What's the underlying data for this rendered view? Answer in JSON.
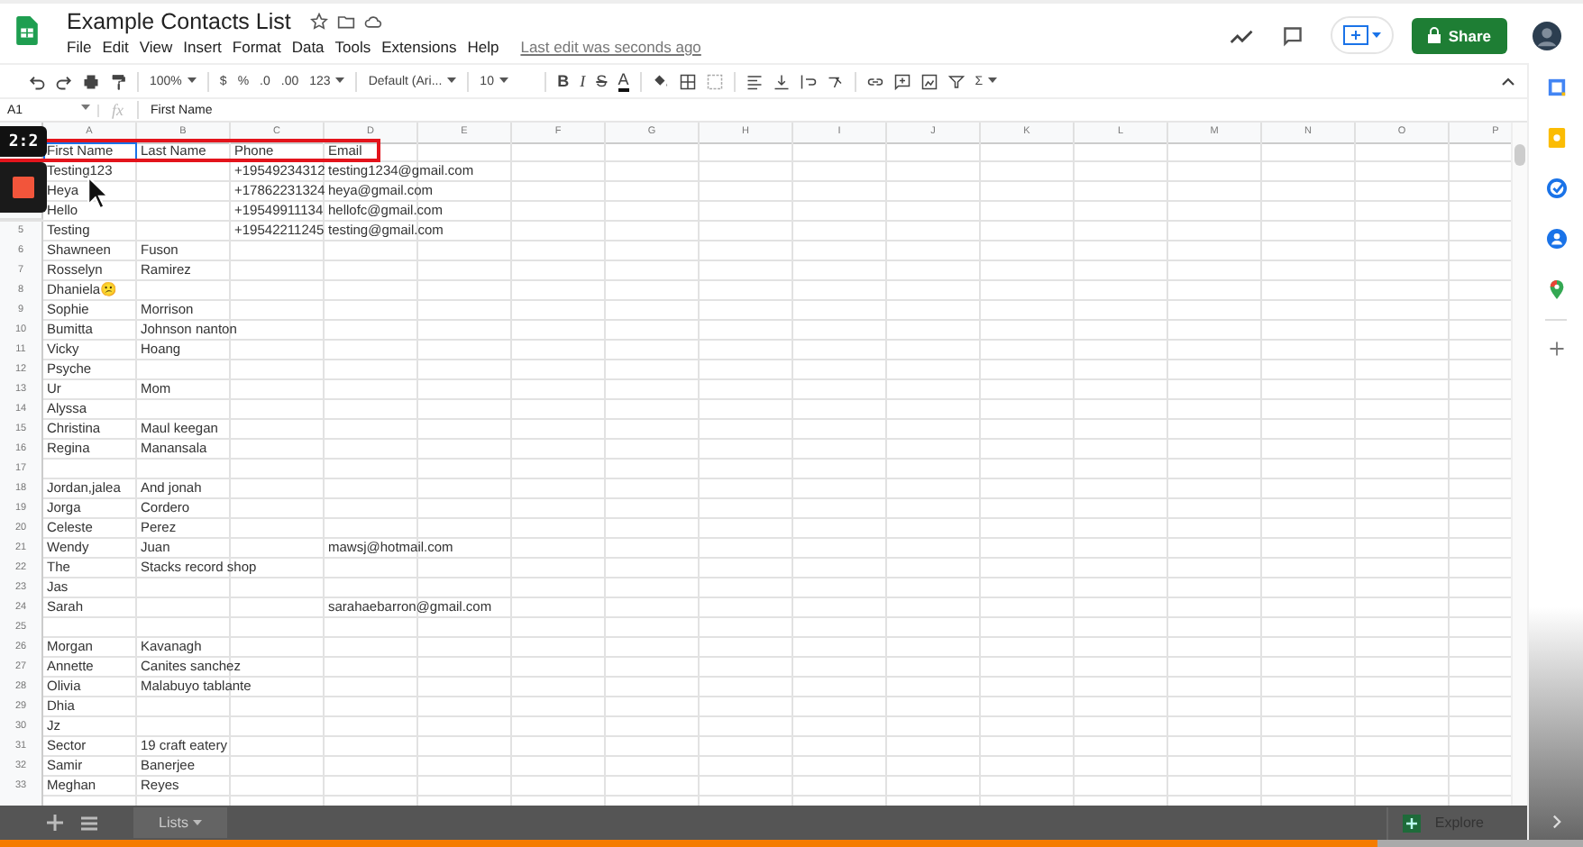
{
  "document": {
    "title": "Example Contacts List",
    "last_edit": "Last edit was seconds ago"
  },
  "menu": [
    "File",
    "Edit",
    "View",
    "Insert",
    "Format",
    "Data",
    "Tools",
    "Extensions",
    "Help"
  ],
  "share_button": "Share",
  "toolbar": {
    "zoom": "100%",
    "currency": "$",
    "percent": "%",
    "decrease_decimals": ".0",
    "increase_decimals": ".00",
    "number_format": "123",
    "font": "Default (Ari...",
    "font_size": "10",
    "bold": "B",
    "italic": "I",
    "strikethrough": "S",
    "text_color": "A",
    "functions": "Σ"
  },
  "formula_bar": {
    "name_box": "A1",
    "fx": "fx",
    "value": "First Name"
  },
  "columns": [
    "A",
    "B",
    "C",
    "D",
    "E",
    "F",
    "G",
    "H",
    "I",
    "J",
    "K",
    "L",
    "M",
    "N",
    "O",
    "P"
  ],
  "rows": [
    {
      "a": "First Name",
      "b": "Last Name",
      "c": "Phone",
      "d": "Email",
      "selected": true,
      "highlighted": true
    },
    {
      "a": "Testing123",
      "c": "+19549234312",
      "d": "testing1234@gmail.com",
      "selected": false,
      "highlighted": false
    },
    {
      "a": "Heya",
      "c": "+17862231324",
      "d": "heya@gmail.com",
      "selected": false,
      "highlighted": false
    },
    {
      "a": "Hello",
      "c": "+19549911134",
      "d": "hellofc@gmail.com",
      "selected": false,
      "highlighted": false
    },
    {
      "number": "5",
      "a": "Testing",
      "c": "+19542211245",
      "d": "testing@gmail.com",
      "selected": false,
      "highlighted": false
    },
    {
      "number": "6",
      "a": "Shawneen",
      "b": "Fuson",
      "selected": false,
      "highlighted": false
    },
    {
      "number": "7",
      "a": "Rosselyn",
      "b": "Ramirez",
      "selected": false,
      "highlighted": false
    },
    {
      "number": "8",
      "a": "Dhaniela😕",
      "selected": false,
      "highlighted": false
    },
    {
      "number": "9",
      "a": "Sophie",
      "b": "Morrison",
      "selected": false,
      "highlighted": false
    },
    {
      "number": "10",
      "a": "Bumitta",
      "b": "Johnson nanton",
      "selected": false,
      "highlighted": false
    },
    {
      "number": "11",
      "a": "Vicky",
      "b": "Hoang",
      "selected": false,
      "highlighted": false
    },
    {
      "number": "12",
      "a": "Psyche",
      "selected": false,
      "highlighted": false
    },
    {
      "number": "13",
      "a": "Ur",
      "b": "Mom",
      "selected": false,
      "highlighted": false
    },
    {
      "number": "14",
      "a": "Alyssa",
      "selected": false,
      "highlighted": false
    },
    {
      "number": "15",
      "a": "Christina",
      "b": "Maul keegan",
      "selected": false,
      "highlighted": false
    },
    {
      "number": "16",
      "a": "Regina",
      "b": "Manansala",
      "selected": false,
      "highlighted": false
    },
    {
      "number": "17",
      "selected": false,
      "highlighted": false
    },
    {
      "number": "18",
      "a": "Jordan,jalea",
      "b": "And jonah",
      "selected": false,
      "highlighted": false
    },
    {
      "number": "19",
      "a": "Jorga",
      "b": "Cordero",
      "selected": false,
      "highlighted": false
    },
    {
      "number": "20",
      "a": "Celeste",
      "b": "Perez",
      "selected": false,
      "highlighted": false
    },
    {
      "number": "21",
      "a": "Wendy",
      "b": "Juan",
      "d": "mawsj@hotmail.com",
      "selected": false,
      "highlighted": false
    },
    {
      "number": "22",
      "a": "The",
      "b": "Stacks record shop",
      "selected": false,
      "highlighted": false
    },
    {
      "number": "23",
      "a": "Jas",
      "selected": false,
      "highlighted": false
    },
    {
      "number": "24",
      "a": "Sarah",
      "d": "sarahaebarron@gmail.com",
      "selected": false,
      "highlighted": false
    },
    {
      "number": "25",
      "selected": false,
      "highlighted": false
    },
    {
      "number": "26",
      "a": "Morgan",
      "b": "Kavanagh",
      "selected": false,
      "highlighted": false
    },
    {
      "number": "27",
      "a": "Annette",
      "b": "Canites sanchez",
      "selected": false,
      "highlighted": false
    },
    {
      "number": "28",
      "a": "Olivia",
      "b": "Malabuyo tablante",
      "selected": false,
      "highlighted": false
    },
    {
      "number": "29",
      "a": "Dhia",
      "selected": false,
      "highlighted": false
    },
    {
      "number": "30",
      "a": "Jz",
      "selected": false,
      "highlighted": false
    },
    {
      "number": "31",
      "a": "Sector",
      "b": "19 craft eatery",
      "selected": false,
      "highlighted": false
    },
    {
      "number": "32",
      "a": "Samir",
      "b": "Banerjee",
      "selected": false,
      "highlighted": false
    },
    {
      "number": "33",
      "a": "Meghan",
      "b": "Reyes",
      "selected": false,
      "highlighted": false
    }
  ],
  "sheet_tabs": [
    {
      "label": "Lists",
      "selected": true
    }
  ],
  "explore_button": "Explore",
  "recording": {
    "timer": "2:2"
  },
  "video_progress": {
    "level": 0.87
  }
}
